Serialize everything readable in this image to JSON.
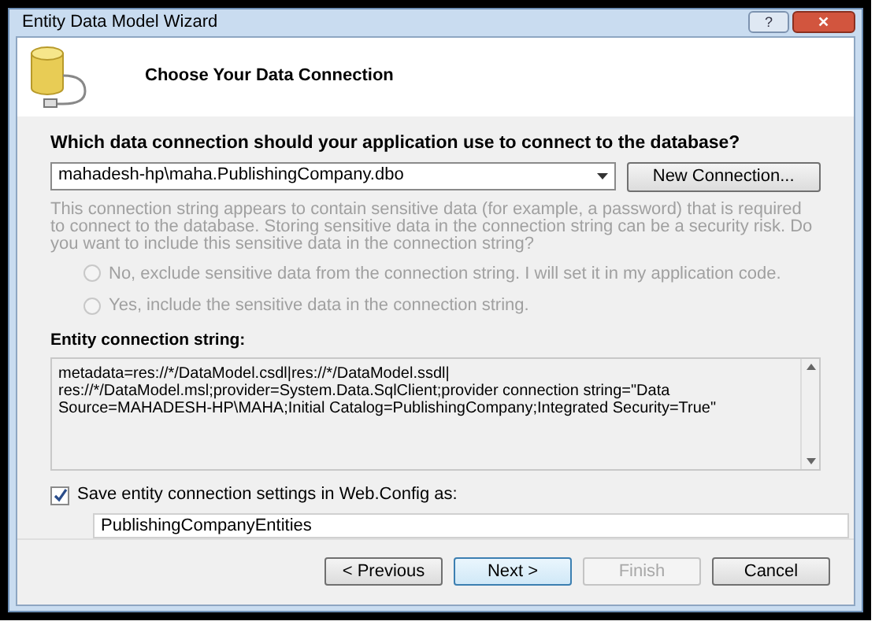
{
  "window": {
    "title": "Entity Data Model Wizard"
  },
  "title_buttons": [
    {
      "kind": "help",
      "label": "?"
    },
    {
      "kind": "close",
      "label": "✕"
    }
  ],
  "header": {
    "title": "Choose Your Data Connection"
  },
  "connection": {
    "label": "Which data connection should your application use to connect to the database?",
    "value": "mahadesh-hp\\maha.PublishingCompany.dbo",
    "button": "New Connection..."
  },
  "sensitive": {
    "text": "This connection string appears to contain sensitive data (for example, a password) that is required to connect to the database. Storing sensitive data in the connection string can be a security risk. Do you want to include this sensitive data in the connection string?",
    "options": [
      {
        "label": "No, exclude sensitive data from the connection string. I will set it in my application code.",
        "selected": false,
        "disabled": true
      },
      {
        "label": "Yes, include the sensitive data in the connection string.",
        "selected": false,
        "disabled": true
      }
    ]
  },
  "entity_string": {
    "label": "Entity connection string:",
    "value": "metadata=res://*/DataModel.csdl|res://*/DataModel.ssdl|\nres://*/DataModel.msl;provider=System.Data.SqlClient;provider connection string=\"Data\nSource=MAHADESH-HP\\MAHA;Initial Catalog=PublishingCompany;Integrated Security=True\""
  },
  "save": {
    "label": "Save entity connection settings in Web.Config as:",
    "checked": true,
    "value": "PublishingCompanyEntities"
  },
  "buttons": [
    {
      "label": "< Previous",
      "disabled": false,
      "default": false
    },
    {
      "label": "Next >",
      "disabled": false,
      "default": true
    },
    {
      "label": "Finish",
      "disabled": true,
      "default": false
    },
    {
      "label": "Cancel",
      "disabled": false,
      "default": false
    }
  ]
}
